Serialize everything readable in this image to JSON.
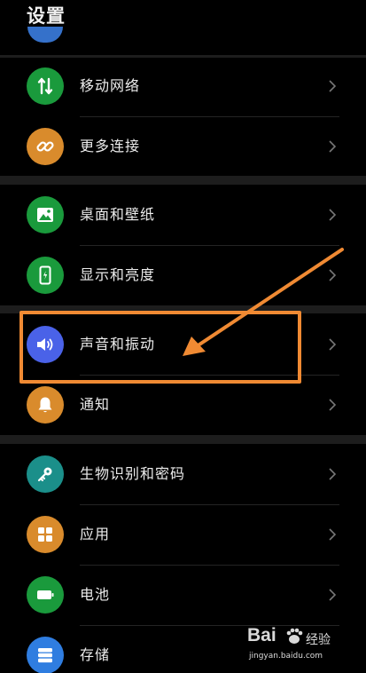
{
  "header": {
    "title": "设置"
  },
  "settings": [
    {
      "label": "移动网络",
      "icon": "mobile-data-icon",
      "color": "#1a9a3c"
    },
    {
      "label": "更多连接",
      "icon": "link-icon",
      "color": "#d98b2c"
    },
    {
      "label": "桌面和壁纸",
      "icon": "wallpaper-icon",
      "color": "#1a9a3c"
    },
    {
      "label": "显示和亮度",
      "icon": "display-icon",
      "color": "#1a9a3c"
    },
    {
      "label": "声音和振动",
      "icon": "volume-icon",
      "color": "#4a62e8"
    },
    {
      "label": "通知",
      "icon": "bell-icon",
      "color": "#d98b2c"
    },
    {
      "label": "生物识别和密码",
      "icon": "key-icon",
      "color": "#1b8f8a"
    },
    {
      "label": "应用",
      "icon": "apps-icon",
      "color": "#d98b2c"
    },
    {
      "label": "电池",
      "icon": "battery-icon",
      "color": "#1a9a3c"
    },
    {
      "label": "存储",
      "icon": "storage-icon",
      "color": "#2f7de0"
    }
  ],
  "annotation": {
    "highlight_color": "#f08a33"
  },
  "watermark": {
    "brand": "Bai",
    "brand_suffix": "经验",
    "url": "jingyan.baidu.com"
  }
}
